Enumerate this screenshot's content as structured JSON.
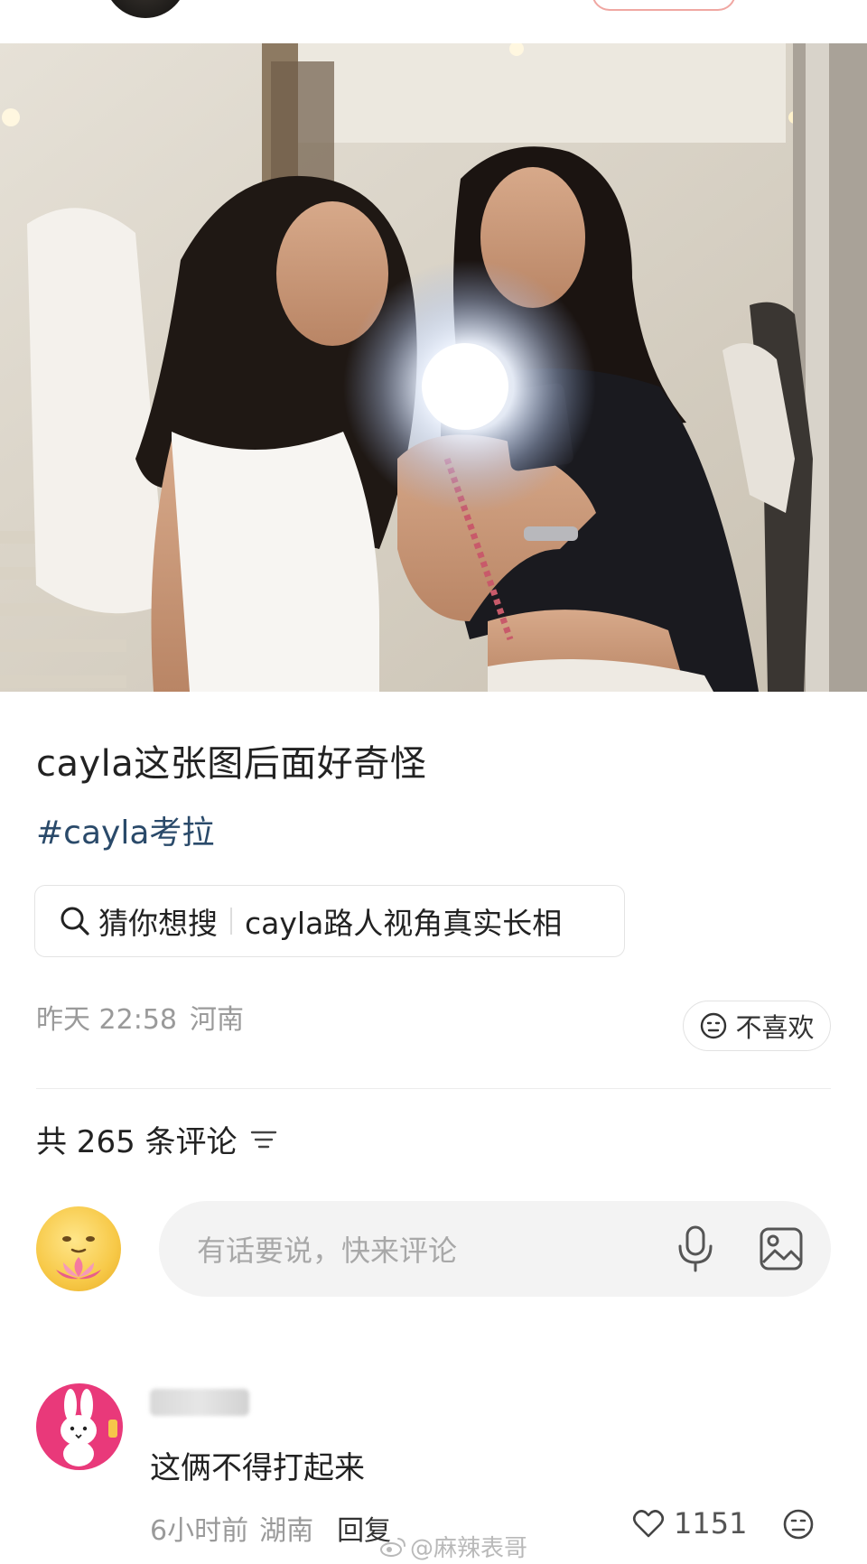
{
  "post": {
    "title": "cayla这张图后面好奇怪",
    "hashtag": "#cayla考拉",
    "guess": {
      "label": "猜你想搜",
      "query": "cayla路人视角真实长相"
    },
    "time": "昨天 22:58",
    "location": "河南",
    "dislike_label": "不喜欢"
  },
  "comments_section": {
    "count_label": "共 265 条评论",
    "input_placeholder": "有话要说，快来评论"
  },
  "comment": {
    "text": "这俩不得打起来",
    "time": "6小时前",
    "location": "湖南",
    "reply_label": "回复",
    "likes": "1151"
  },
  "watermark": "@麻辣表哥",
  "colors": {
    "hashtag": "#2a4a6a",
    "muted": "#9a9a9a",
    "avatar_pink": "#e9397a"
  },
  "icons": {
    "search": "search-icon",
    "dislike": "neutral-face-icon",
    "sort": "sort-lines-icon",
    "mic": "microphone-icon",
    "image": "image-icon",
    "heart": "heart-icon"
  }
}
